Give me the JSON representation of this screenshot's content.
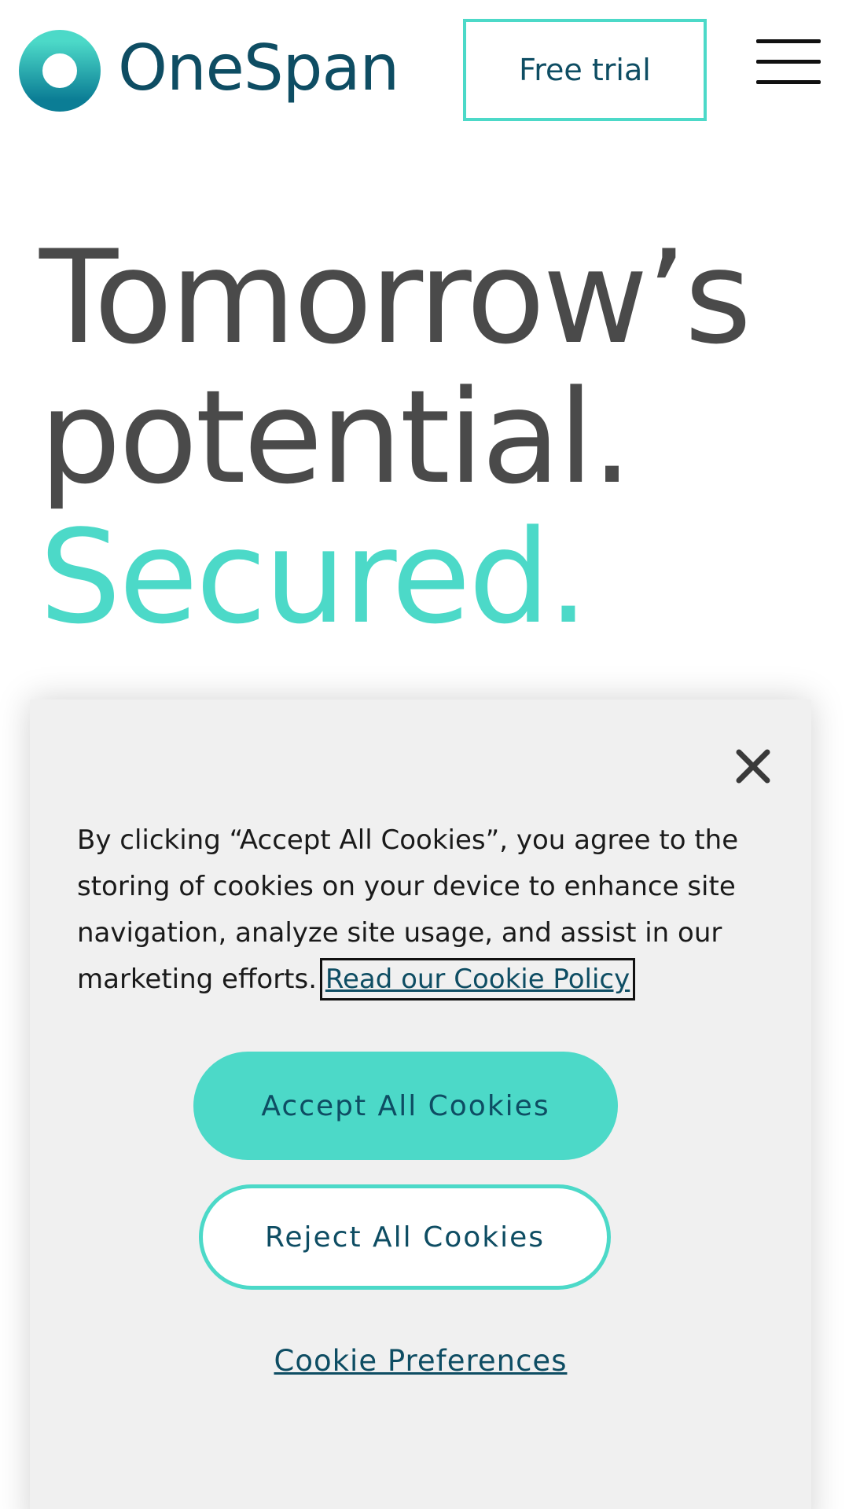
{
  "header": {
    "logo_text": "OneSpan",
    "free_trial_label": "Free trial"
  },
  "hero": {
    "line1": "Tomorrow’s",
    "line2": "potential.",
    "line3": "Secured."
  },
  "cookie_banner": {
    "message": "By clicking “Accept All Cookies”, you agree to the storing of cookies on your device to enhance site navigation, analyze site usage, and assist in our marketing efforts.",
    "policy_link": "Read our Cookie Policy",
    "accept_label": "Accept All Cookies",
    "reject_label": "Reject All Cookies",
    "preferences_label": "Cookie Preferences"
  },
  "colors": {
    "brand_dark": "#0e4d63",
    "accent_teal": "#4cd9c8",
    "hero_gray": "#4a4a4a",
    "banner_bg": "#f0f0f0"
  },
  "icons": {
    "logo": "onespan-ring-icon",
    "menu": "hamburger-menu-icon",
    "close": "close-icon"
  }
}
